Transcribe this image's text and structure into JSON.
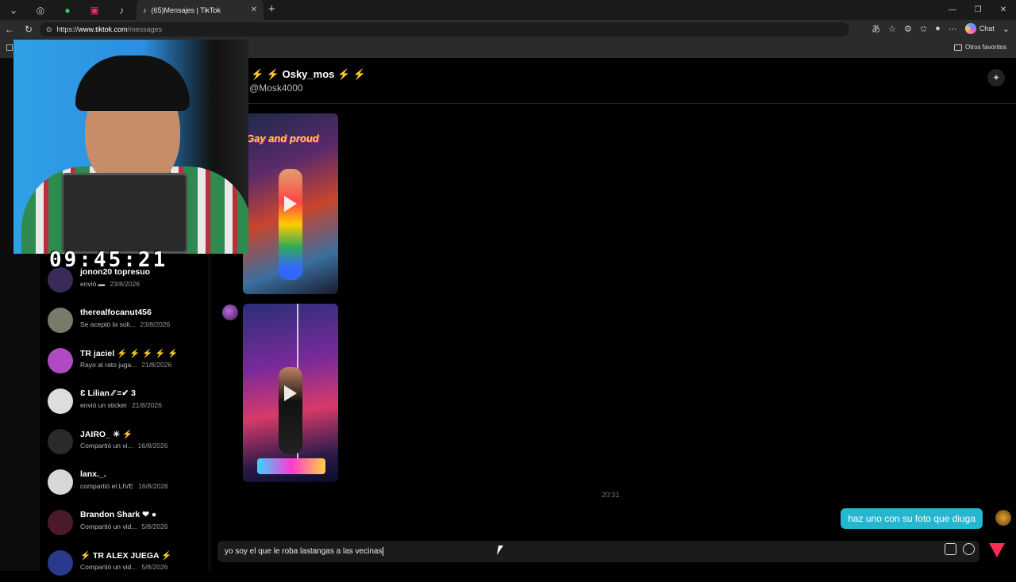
{
  "browser": {
    "tab_title": "(65)Mensajes | TikTok",
    "url_scheme": "https://",
    "url_host": "www.tiktok.com",
    "url_path": "/messages",
    "chat_button_label": "Chat",
    "favorites_label": "Otros favoritos"
  },
  "chat": {
    "name": "Osky_mos",
    "handle": "@Mosk4000",
    "media1_caption": "Gay and proud",
    "timestamp": "20:31",
    "sent_message": "haz uno con su foto que diuga",
    "composer_text": "yo soy el que le roba lastangas a las vecinas"
  },
  "conversations": [
    {
      "name": "jonon20 topresuo",
      "preview": "envió ▬",
      "date": "23/8/2026",
      "color": "#3a2a5a"
    },
    {
      "name": "therealfocanut456",
      "preview": "Se aceptó la soli...",
      "date": "23/8/2026",
      "color": "#7a7a6a"
    },
    {
      "name": "TR jaciel ⚡ ⚡ ⚡ ⚡ ⚡",
      "preview": "Rayo al rato juga...",
      "date": "21/8/2026",
      "color": "#b04ac0"
    },
    {
      "name": "Ɛ Lilian ⁄⁄ ≡✔ 3",
      "preview": "envió un sticker",
      "date": "21/8/2026",
      "color": "#dddddd"
    },
    {
      "name": "JAIRO_ ☀ ⚡",
      "preview": "Compartió un vi...",
      "date": "16/8/2026",
      "color": "#2a2a2a"
    },
    {
      "name": "lanx._.",
      "preview": "compartió el LIVE",
      "date": "16/8/2026",
      "color": "#d8d8d8"
    },
    {
      "name": "Brandon Shark ❤ ●",
      "preview": "Compartió un vid...",
      "date": "5/8/2026",
      "color": "#4a1a2a"
    },
    {
      "name": "⚡ TR ALEX JUEGA ⚡",
      "preview": "Compartió un vid...",
      "date": "5/8/2026",
      "color": "#2a3a8a"
    }
  ],
  "overlay": {
    "timer": "09:45:21"
  },
  "colors": {
    "bubble": "#25b7d0",
    "send": "#fe2c55",
    "bolt": "#ff7a1a"
  }
}
